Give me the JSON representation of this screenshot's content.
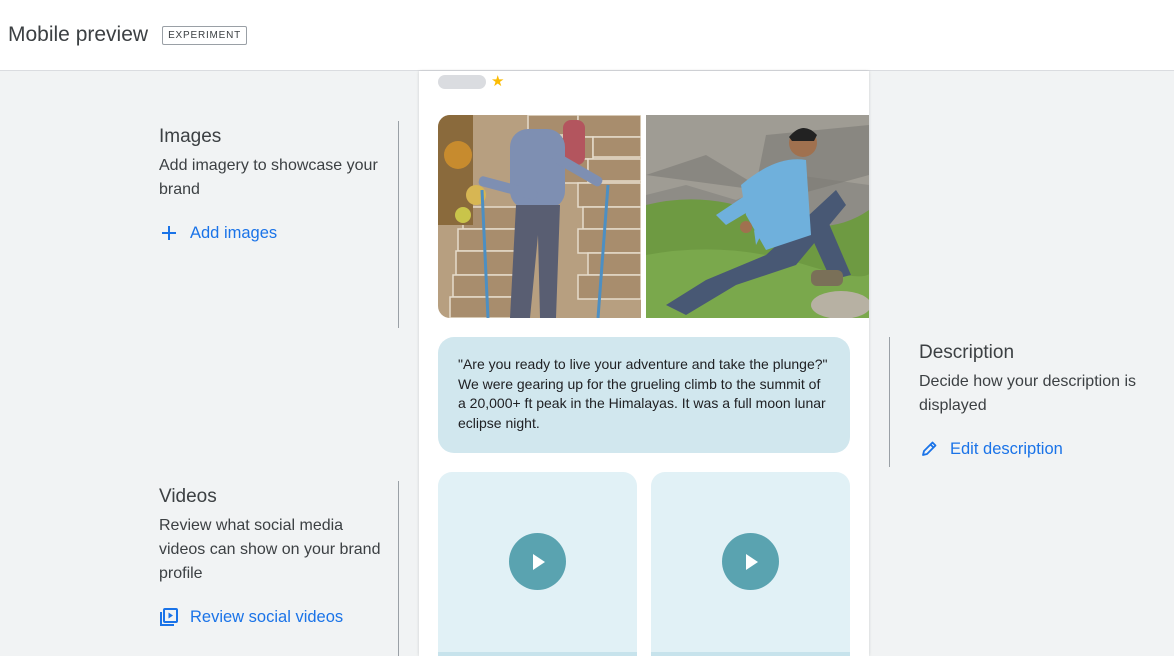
{
  "header": {
    "title": "Mobile preview",
    "badge": "EXPERIMENT"
  },
  "preview": {
    "rating_star": "★",
    "description_text": "\"Are you ready to live your adventure and take the plunge?\" We were gearing up for the grueling climb to the summit of a 20,000+ ft peak in the Himalayas. It was a full moon lunar eclipse night.",
    "colors": {
      "description_card": "#d1e7ee",
      "video_card": "#e1f1f6",
      "play_button": "#5aa3b0",
      "star": "#fbbc04"
    }
  },
  "sections": {
    "images": {
      "title": "Images",
      "subtitle": "Add imagery to showcase your brand",
      "action": "Add images",
      "icon": "plus-icon"
    },
    "description": {
      "title": "Description",
      "subtitle": "Decide how your description is displayed",
      "action": "Edit description",
      "icon": "pencil-icon"
    },
    "videos": {
      "title": "Videos",
      "subtitle": "Review what social media videos can show on your brand profile",
      "action": "Review social videos",
      "icon": "video-library-icon"
    }
  },
  "accent_color": "#1a73e8"
}
